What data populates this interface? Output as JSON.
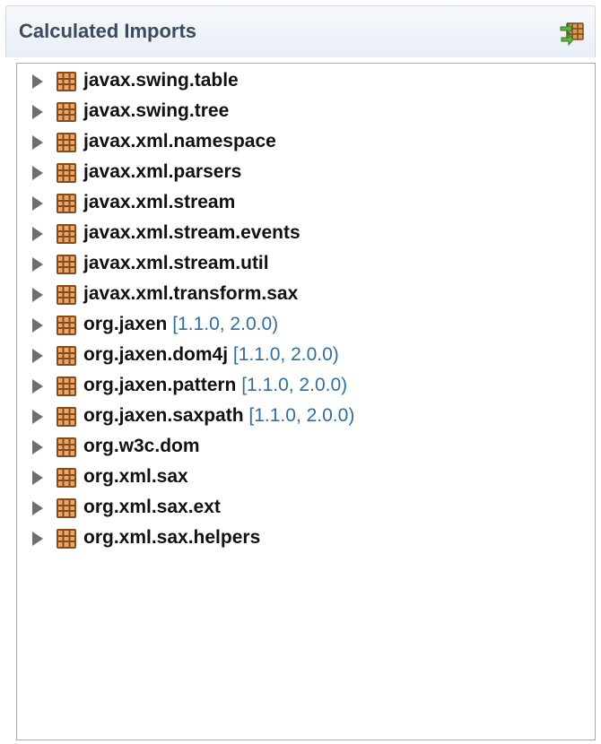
{
  "panel": {
    "title": "Calculated Imports",
    "header_button_icon": "import-export-icon"
  },
  "tree": {
    "items": [
      {
        "name": "javax.swing.table",
        "version": ""
      },
      {
        "name": "javax.swing.tree",
        "version": ""
      },
      {
        "name": "javax.xml.namespace",
        "version": ""
      },
      {
        "name": "javax.xml.parsers",
        "version": ""
      },
      {
        "name": "javax.xml.stream",
        "version": ""
      },
      {
        "name": "javax.xml.stream.events",
        "version": ""
      },
      {
        "name": "javax.xml.stream.util",
        "version": ""
      },
      {
        "name": "javax.xml.transform.sax",
        "version": ""
      },
      {
        "name": "org.jaxen",
        "version": "[1.1.0, 2.0.0)"
      },
      {
        "name": "org.jaxen.dom4j",
        "version": "[1.1.0, 2.0.0)"
      },
      {
        "name": "org.jaxen.pattern",
        "version": "[1.1.0, 2.0.0)"
      },
      {
        "name": "org.jaxen.saxpath",
        "version": "[1.1.0, 2.0.0)"
      },
      {
        "name": "org.w3c.dom",
        "version": ""
      },
      {
        "name": "org.xml.sax",
        "version": ""
      },
      {
        "name": "org.xml.sax.ext",
        "version": ""
      },
      {
        "name": "org.xml.sax.helpers",
        "version": ""
      }
    ],
    "expander_icon": "chevron-right-icon",
    "package_icon": "package-icon"
  },
  "colors": {
    "title": "#3b4a5e",
    "version": "#2f6f9f",
    "package_icon": "#8b4a1c"
  }
}
